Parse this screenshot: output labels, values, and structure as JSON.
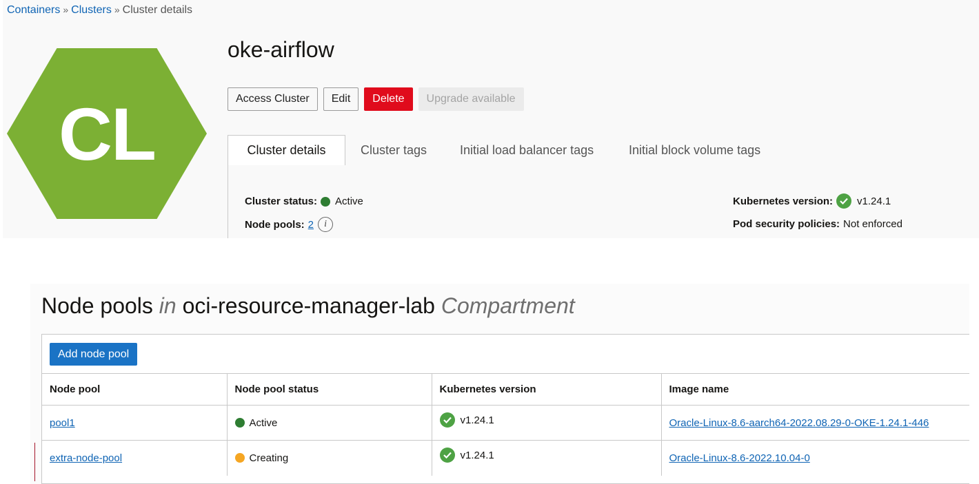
{
  "breadcrumb": [
    {
      "label": "Containers",
      "link": true
    },
    {
      "label": "Clusters",
      "link": true
    },
    {
      "label": "Cluster details",
      "link": false
    }
  ],
  "breadcrumb_sep": "»",
  "hex_badge": {
    "text": "CL",
    "color": "#7cb034"
  },
  "cluster": {
    "name": "oke-airflow"
  },
  "actions": {
    "access": "Access Cluster",
    "edit": "Edit",
    "delete": "Delete",
    "upgrade": "Upgrade available"
  },
  "tabs": [
    "Cluster details",
    "Cluster tags",
    "Initial load balancer tags",
    "Initial block volume tags"
  ],
  "details": {
    "status_label": "Cluster status:",
    "status_value": "Active",
    "node_pools_label": "Node pools:",
    "node_pools_value": "2",
    "k8s_label": "Kubernetes version:",
    "k8s_value": "v1.24.1",
    "psp_label": "Pod security policies:",
    "psp_value": "Not enforced"
  },
  "node_pools": {
    "title_prefix": "Node pools",
    "title_in": "in",
    "compartment": "oci-resource-manager-lab",
    "title_suffix": "Compartment",
    "add_button": "Add node pool",
    "columns": [
      "Node pool",
      "Node pool status",
      "Kubernetes version",
      "Image name"
    ],
    "rows": [
      {
        "name": "pool1",
        "status": "Active",
        "status_color": "green",
        "version": "v1.24.1",
        "image": "Oracle-Linux-8.6-aarch64-2022.08.29-0-OKE-1.24.1-446"
      },
      {
        "name": "extra-node-pool",
        "status": "Creating",
        "status_color": "orange",
        "version": "v1.24.1",
        "image": "Oracle-Linux-8.6-2022.10.04-0"
      }
    ]
  },
  "colors": {
    "primary": "#1a73c5",
    "danger": "#e00b1c",
    "active": "#2e7d32",
    "creating": "#f5a623",
    "check": "#4ea244"
  }
}
